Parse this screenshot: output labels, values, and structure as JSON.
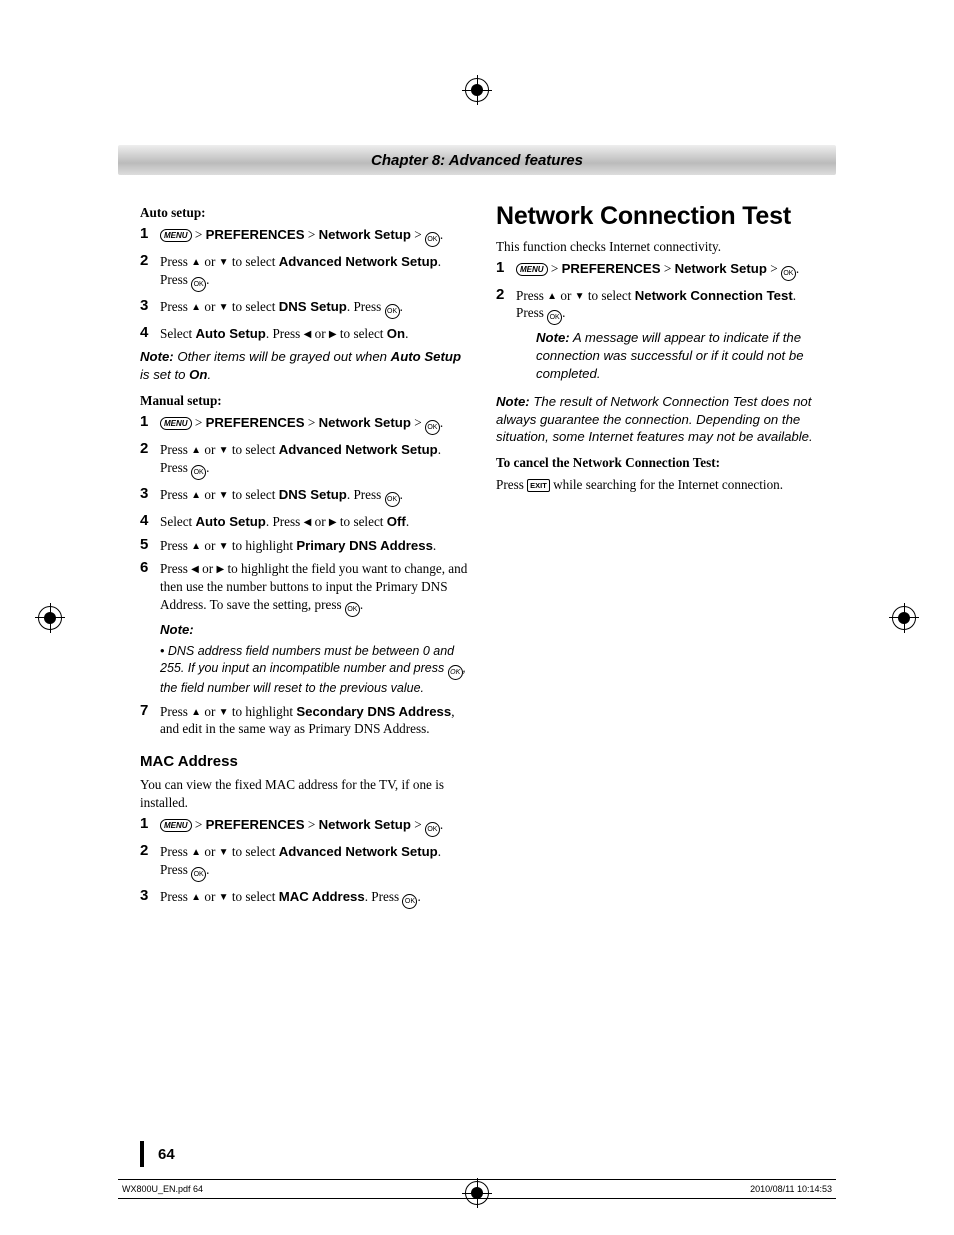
{
  "chapter_header": "Chapter 8: Advanced features",
  "left": {
    "auto_setup_heading": "Auto setup:",
    "auto_steps": {
      "s1a": "PREFERENCES",
      "s1b": "Network Setup",
      "s2a": "Press ",
      "s2b": " or ",
      "s2c": " to select ",
      "s2d": "Advanced Network Setup",
      "s2e": ". Press ",
      "s3a": "Press ",
      "s3b": " or ",
      "s3c": " to select ",
      "s3d": "DNS Setup",
      "s3e": ". Press ",
      "s4a": "Select ",
      "s4b": "Auto Setup",
      "s4c": ". Press ",
      "s4d": " or ",
      "s4e": " to select ",
      "s4f": "On",
      "s4g": "."
    },
    "auto_note_label": "Note:",
    "auto_note_a": " Other items will be grayed out when ",
    "auto_note_b": "Auto Setup",
    "auto_note_c": " is set to ",
    "auto_note_d": "On",
    "auto_note_e": ".",
    "manual_setup_heading": "Manual setup:",
    "manual_steps": {
      "s1a": "PREFERENCES",
      "s1b": "Network Setup",
      "s2a": "Press ",
      "s2b": " or ",
      "s2c": " to select ",
      "s2d": "Advanced Network Setup",
      "s2e": ". Press ",
      "s3a": "Press ",
      "s3b": " or ",
      "s3c": " to select ",
      "s3d": "DNS Setup",
      "s3e": ". Press ",
      "s4a": "Select ",
      "s4b": "Auto Setup",
      "s4c": ". Press ",
      "s4d": " or ",
      "s4e": " to select ",
      "s4f": "Off",
      "s4g": ".",
      "s5a": "Press ",
      "s5b": " or ",
      "s5c": " to highlight ",
      "s5d": "Primary DNS Address",
      "s5e": ".",
      "s6a": "Press ",
      "s6b": " or ",
      "s6c": " to highlight the field you want to change, and then use the number buttons to input the Primary DNS Address. To save the setting, press ",
      "s6_note_label": "Note:",
      "s6_bullet": "DNS address field numbers must be between 0 and 255. If you input an incompatible number and press ",
      "s6_bullet_b": ", the field number will reset to the previous value.",
      "s7a": "Press ",
      "s7b": " or ",
      "s7c": " to highlight ",
      "s7d": "Secondary DNS Address",
      "s7e": ", and edit in the same way as Primary DNS Address."
    },
    "mac_heading": "MAC Address",
    "mac_intro": "You can view the fixed MAC address for the TV, if one is installed.",
    "mac_steps": {
      "s1a": "PREFERENCES",
      "s1b": "Network Setup",
      "s2a": "Press ",
      "s2b": " or ",
      "s2c": " to select ",
      "s2d": "Advanced Network Setup",
      "s2e": ". Press ",
      "s3a": "Press ",
      "s3b": " or ",
      "s3c": " to select ",
      "s3d": "MAC Address",
      "s3e": ". Press "
    }
  },
  "right": {
    "title": "Network Connection Test",
    "intro": "This function checks Internet connectivity.",
    "steps": {
      "s1a": "PREFERENCES",
      "s1b": "Network Setup",
      "s2a": "Press ",
      "s2b": " or ",
      "s2c": " to select ",
      "s2d": "Network Connection Test",
      "s2e": ". Press ",
      "s2_note_label": "Note:",
      "s2_note_text": " A message will appear to indicate if the connection was successful or if it could not be completed."
    },
    "outer_note_label": "Note:",
    "outer_note_text": " The result of Network Connection Test does not always guarantee the connection. Depending on the situation, some Internet features may not be available.",
    "cancel_heading": "To cancel the Network Connection Test:",
    "cancel_a": "Press ",
    "cancel_b": " while searching for the Internet connection."
  },
  "icons": {
    "menu": "MENU",
    "ok": "OK",
    "exit": "EXIT",
    "up": "▲",
    "down": "▼",
    "left": "◀",
    "right": "▶",
    "gt": ">"
  },
  "page_number": "64",
  "footer_left": "WX800U_EN.pdf    64",
  "footer_right": "2010/08/11   10:14:53"
}
